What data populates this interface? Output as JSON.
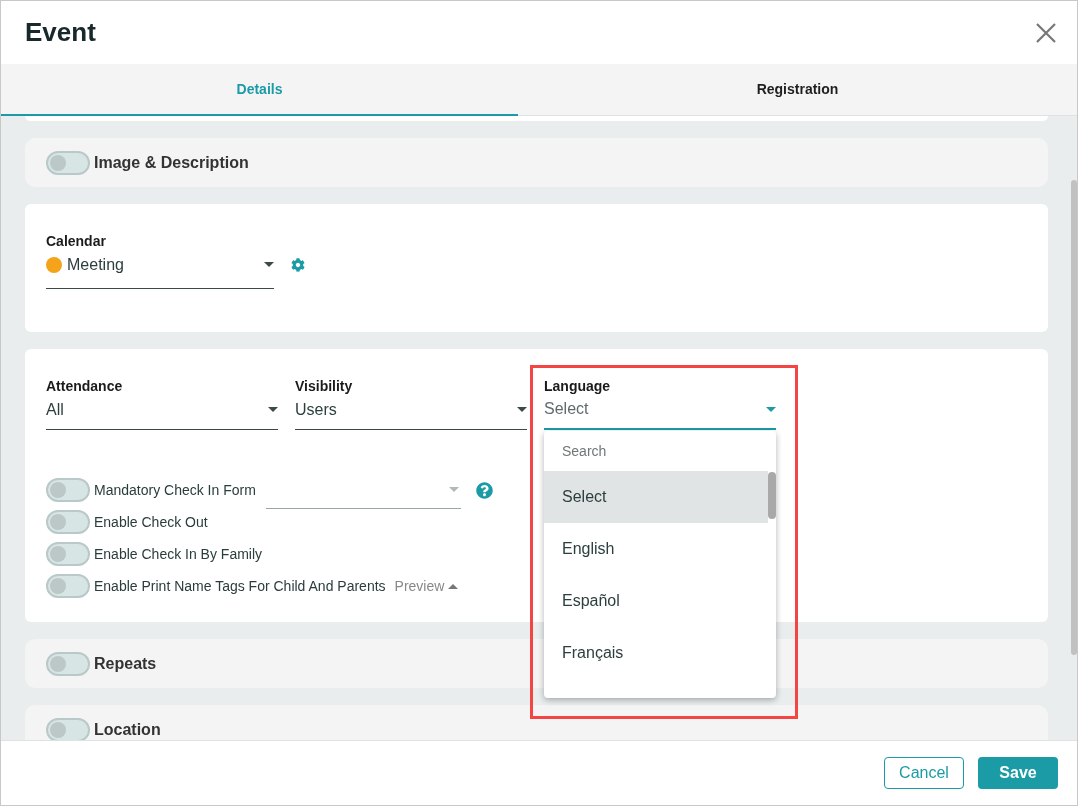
{
  "window": {
    "title": "Event"
  },
  "tabs": [
    {
      "label": "Details",
      "selected": true
    },
    {
      "label": "Registration",
      "selected": false
    }
  ],
  "sections": [
    {
      "kind": "toggle",
      "label": "Image & Description",
      "on": false
    },
    {
      "kind": "calendar",
      "label": "Calendar",
      "value": "Meeting",
      "color": "#f5a31a"
    },
    {
      "kind": "settings",
      "fields": [
        {
          "label": "Attendance",
          "value": "All",
          "open": false
        },
        {
          "label": "Visibility",
          "value": "Users",
          "open": false
        },
        {
          "label": "Language",
          "placeholder": "Select",
          "open": true,
          "menu": {
            "search_placeholder": "Search",
            "options": [
              {
                "label": "Select",
                "selected": true
              },
              {
                "label": "English",
                "selected": false
              },
              {
                "label": "Español",
                "selected": false
              },
              {
                "label": "Français",
                "selected": false
              }
            ]
          }
        }
      ],
      "options": [
        {
          "kind": "select",
          "label": "Mandatory Check In Form",
          "on": false
        },
        {
          "kind": "plain",
          "label": "Enable Check Out",
          "on": false
        },
        {
          "kind": "plain",
          "label": "Enable Check In By Family",
          "on": false
        },
        {
          "kind": "link",
          "label": "Enable Print Name Tags For Child And Parents",
          "on": false,
          "link": "Preview"
        }
      ]
    },
    {
      "kind": "toggle",
      "label": "Repeats",
      "on": false
    },
    {
      "kind": "toggle",
      "label": "Location",
      "on": false
    }
  ],
  "buttons": [
    {
      "label": "Cancel",
      "kind": "secondary"
    },
    {
      "label": "Save",
      "kind": "primary"
    }
  ]
}
